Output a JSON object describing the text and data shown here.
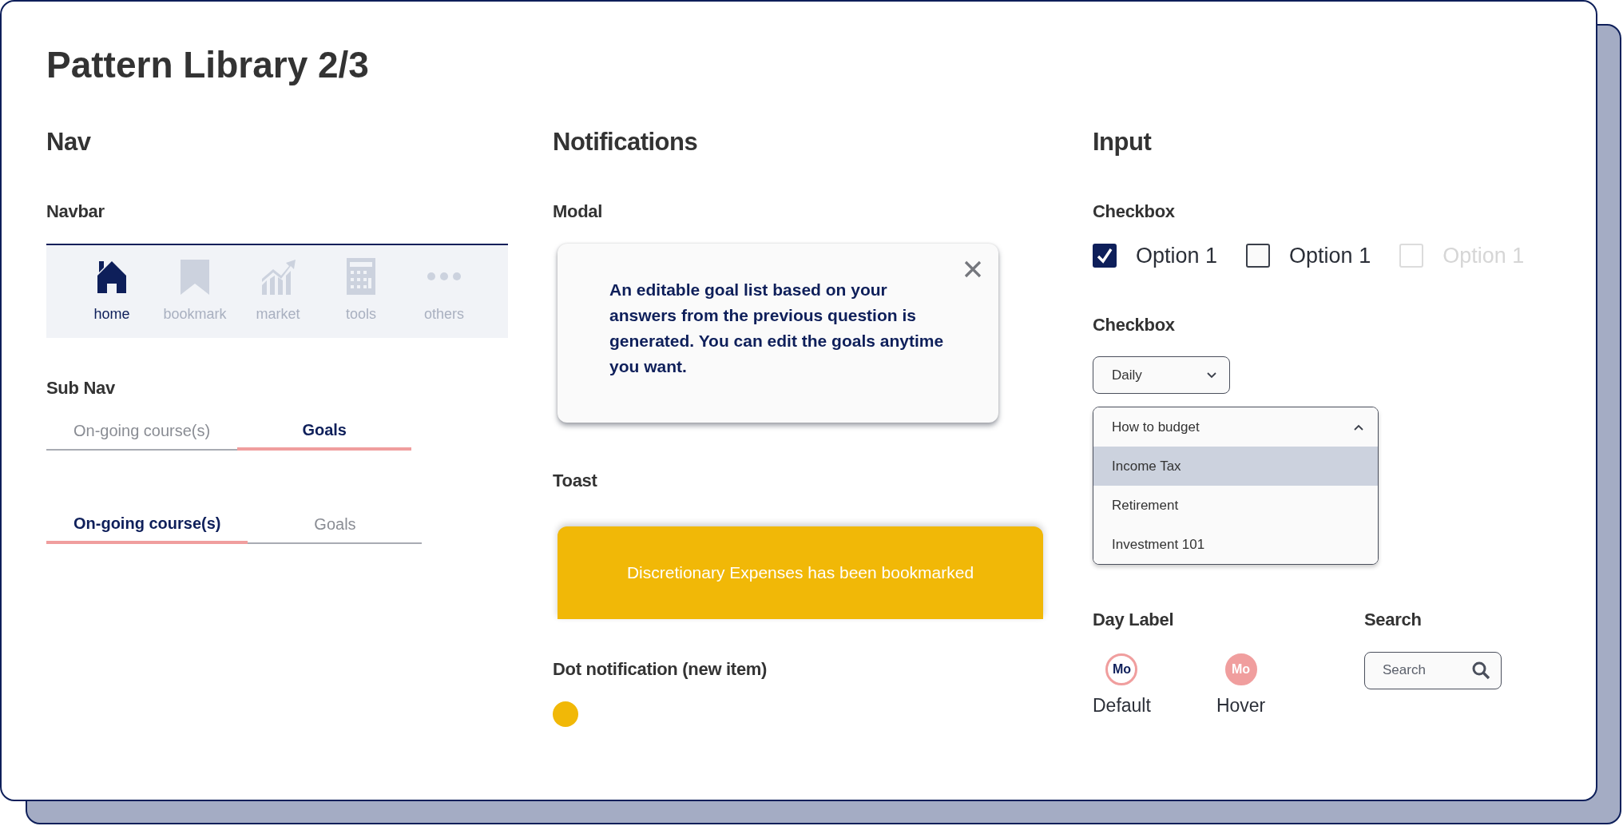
{
  "title": "Pattern Library 2/3",
  "nav": {
    "heading": "Nav",
    "navbar": {
      "heading": "Navbar",
      "items": [
        {
          "label": "home",
          "kind": "home",
          "selected": true
        },
        {
          "label": "bookmark",
          "kind": "bookmark",
          "selected": false
        },
        {
          "label": "market",
          "kind": "chart",
          "selected": false
        },
        {
          "label": "tools",
          "kind": "calculator",
          "selected": false
        },
        {
          "label": "others",
          "kind": "dots",
          "selected": false
        }
      ]
    },
    "sub_nav": {
      "heading": "Sub Nav",
      "variants": [
        {
          "tabs": [
            {
              "label": "On-going course(s)",
              "selected": false
            },
            {
              "label": "Goals",
              "selected": true
            }
          ]
        },
        {
          "tabs": [
            {
              "label": "On-going course(s)",
              "selected": true
            },
            {
              "label": "Goals",
              "selected": false
            }
          ]
        }
      ]
    }
  },
  "notifications": {
    "heading": "Notifications",
    "modal": {
      "heading": "Modal",
      "text": "An editable goal list based on your answers from the previous question is generated. You can edit the goals anytime you want."
    },
    "toast": {
      "heading": "Toast",
      "message": "Discretionary Expenses has been bookmarked"
    },
    "dot": {
      "heading": "Dot notification (new item)"
    }
  },
  "input": {
    "heading": "Input",
    "checkbox": {
      "heading": "Checkbox",
      "options": [
        {
          "label": "Option 1",
          "checked": true,
          "disabled": false
        },
        {
          "label": "Option 1",
          "checked": false,
          "disabled": false
        },
        {
          "label": "Option 1",
          "checked": false,
          "disabled": true
        }
      ]
    },
    "select": {
      "heading": "Checkbox",
      "value": "Daily",
      "expanded": false
    },
    "dropdown": {
      "value": "How to budget",
      "expanded": true,
      "options": [
        {
          "label": "Income Tax",
          "selected": true
        },
        {
          "label": "Retirement",
          "selected": false
        },
        {
          "label": "Investment 101",
          "selected": false
        }
      ]
    },
    "day_label": {
      "heading": "Day Label",
      "samples": [
        {
          "day": "Mo",
          "caption": "Default",
          "hover": false
        },
        {
          "day": "Mo",
          "caption": "Hover",
          "hover": true
        }
      ]
    },
    "search": {
      "heading": "Search",
      "placeholder": "Search"
    }
  }
}
